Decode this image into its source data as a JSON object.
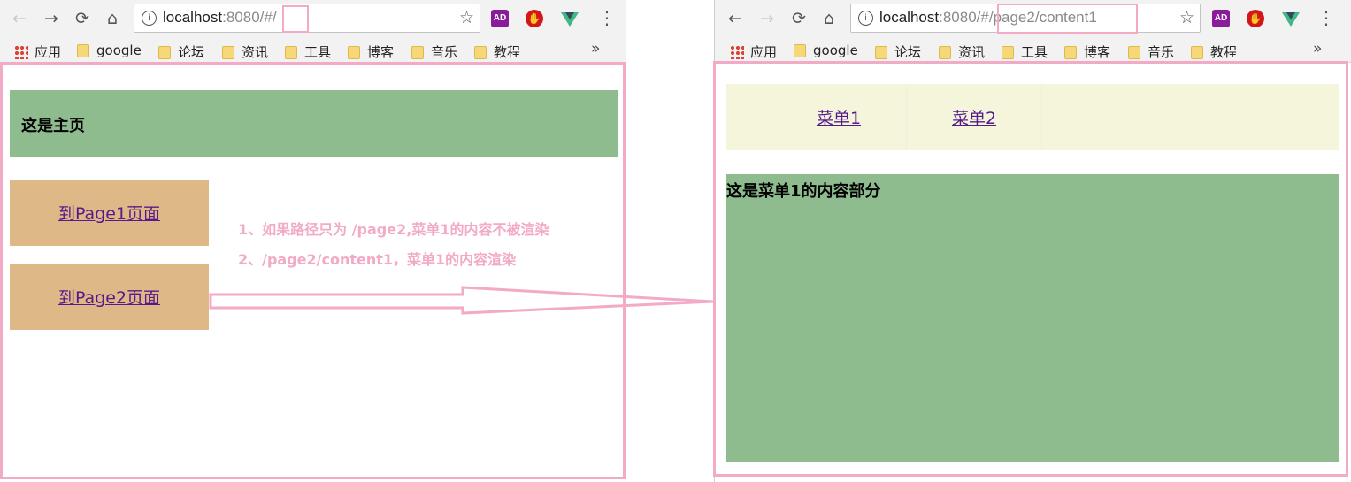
{
  "left_window": {
    "nav": {
      "back": "←",
      "forward": "→",
      "reload": "⟳",
      "home": "⌂"
    },
    "url": {
      "host": "localhost",
      "port_path": ":8080/#",
      "route": "/"
    },
    "bookmarks_bar": {
      "items": [
        "应用",
        "google",
        "论坛",
        "资讯",
        "工具",
        "博客",
        "音乐",
        "教程"
      ],
      "more": "»"
    },
    "extensions": {
      "ad_label": "AD",
      "stop_label": "✋"
    },
    "page": {
      "title": "这是主页",
      "page1_link": "到Page1页面",
      "page2_link": "到Page2页面"
    }
  },
  "right_window": {
    "nav": {
      "back": "←",
      "forward": "→",
      "reload": "⟳",
      "home": "⌂"
    },
    "url": {
      "host": "localhost",
      "port_path": ":8080/#",
      "route": "/page2/content1"
    },
    "bookmarks_bar": {
      "items": [
        "应用",
        "google",
        "论坛",
        "资讯",
        "工具",
        "博客",
        "音乐",
        "教程"
      ],
      "more": "»"
    },
    "extensions": {
      "ad_label": "AD",
      "stop_label": "✋"
    },
    "page": {
      "menu1": "菜单1",
      "menu2": "菜单2",
      "content_title": "这是菜单1的内容部分"
    }
  },
  "annotations": {
    "note1": "1、如果路径只为 /page2,菜单1的内容不被渲染",
    "note2": "2、/page2/content1，菜单1的内容渲染"
  },
  "colors": {
    "annotation_pink": "#f2aac6",
    "header_green": "#8fbc8f",
    "menu_beige": "#f5f5dc",
    "button_tan": "#deb887",
    "link_purple": "#551a8b"
  },
  "icons": [
    "back-arrow-icon",
    "forward-arrow-icon",
    "reload-icon",
    "home-icon",
    "info-icon",
    "star-icon",
    "apps-grid-icon",
    "folder-icon",
    "more-chevron-icon",
    "menu-dots-icon"
  ]
}
